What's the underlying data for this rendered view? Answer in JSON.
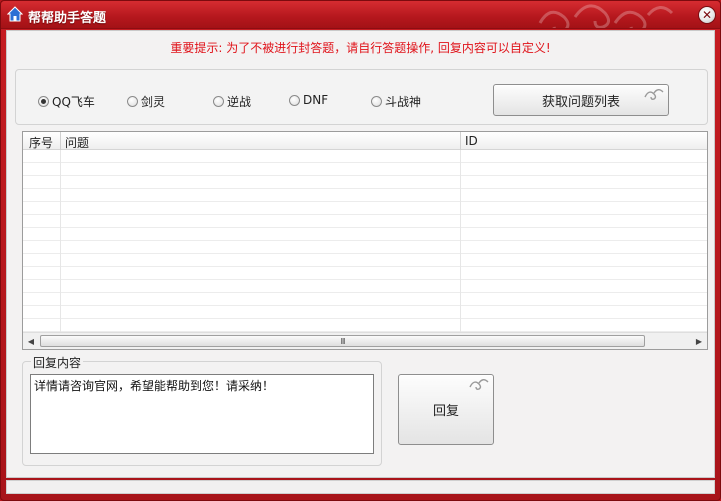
{
  "window": {
    "title": "帮帮助手答题",
    "close_glyph": "✕"
  },
  "notice": "重要提示: 为了不被进行封答题，请自行答题操作, 回复内容可以自定义!",
  "games": {
    "options": [
      {
        "label": "QQ飞车",
        "checked": true
      },
      {
        "label": "剑灵",
        "checked": false
      },
      {
        "label": "逆战",
        "checked": false
      },
      {
        "label": "DNF",
        "checked": false
      },
      {
        "label": "斗战神",
        "checked": false
      }
    ],
    "fetch_button": "获取问题列表"
  },
  "question_list": {
    "columns": [
      "序号",
      "问题",
      "ID"
    ],
    "rows": []
  },
  "scrollbar": {
    "thumb_grip": "III"
  },
  "reply": {
    "group_label": "回复内容",
    "text": "详情请咨询官网，希望能帮助到您！请采纳！",
    "button": "回复"
  },
  "colors": {
    "title_bar": "#b5171d",
    "notice_text": "#e0131a",
    "client_bg": "#f3f2f2"
  }
}
